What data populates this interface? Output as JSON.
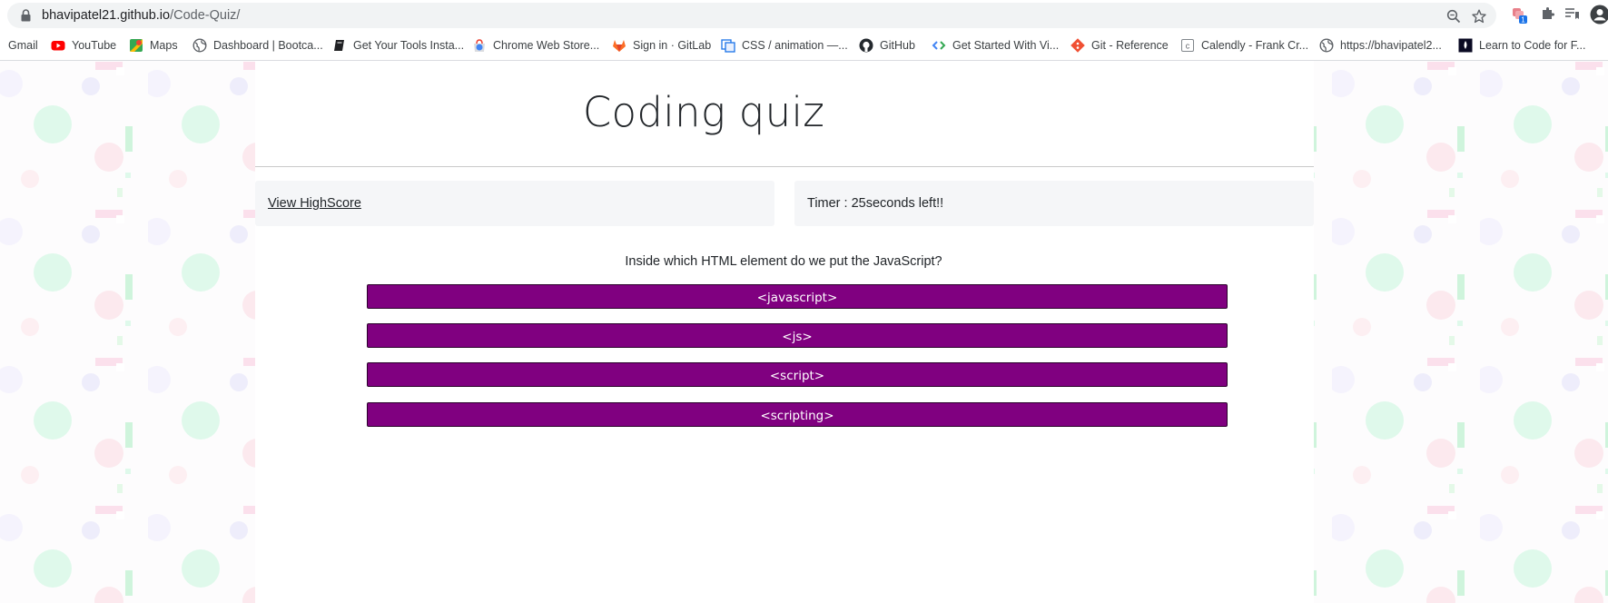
{
  "browser": {
    "url_host": "bhavipatel21.github.io",
    "url_path": "/Code-Quiz/",
    "extension_badge": "1",
    "bookmarks": [
      {
        "label": "Gmail",
        "icon": "gmail-icon"
      },
      {
        "label": "YouTube",
        "icon": "youtube-icon"
      },
      {
        "label": "Maps",
        "icon": "maps-icon"
      },
      {
        "label": "Dashboard | Bootca...",
        "icon": "globe-icon"
      },
      {
        "label": "Get Your Tools Insta...",
        "icon": "book-icon"
      },
      {
        "label": "Chrome Web Store...",
        "icon": "chrome-store-icon"
      },
      {
        "label": "Sign in · GitLab",
        "icon": "gitlab-icon"
      },
      {
        "label": "CSS / animation —...",
        "icon": "mdn-icon"
      },
      {
        "label": "GitHub",
        "icon": "github-icon"
      },
      {
        "label": "Get Started With Vi...",
        "icon": "code-icon"
      },
      {
        "label": "Git - Reference",
        "icon": "git-icon"
      },
      {
        "label": "Calendly - Frank Cr...",
        "icon": "calendly-icon"
      },
      {
        "label": "https://bhavipatel2...",
        "icon": "globe-icon"
      },
      {
        "label": "Learn to Code for F...",
        "icon": "freecodecamp-icon"
      }
    ]
  },
  "quiz": {
    "title": "Coding quiz",
    "highscore_link": "View HighScore",
    "timer": "Timer : 25seconds left!!",
    "question": "Inside which HTML element do we put the JavaScript?",
    "answers": [
      "<javascript>",
      "<js>",
      "<script>",
      "<scripting>"
    ]
  },
  "colors": {
    "answer_button": "#800080",
    "panel_background": "#f5f6f8",
    "title_text": "#212529"
  }
}
